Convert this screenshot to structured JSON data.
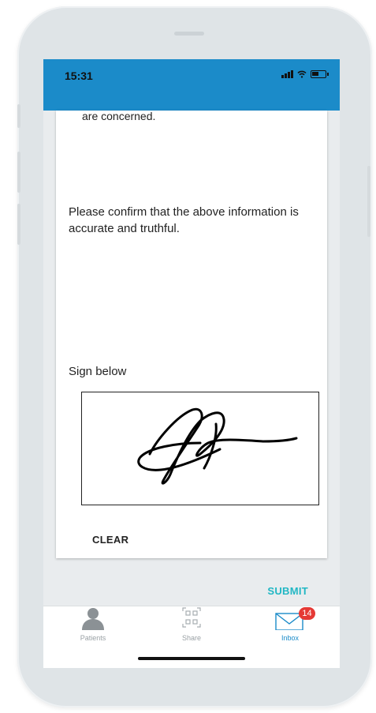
{
  "status_bar": {
    "time": "15:31",
    "background": "#1b8bc9"
  },
  "form": {
    "clipped_text": "are concerned.",
    "confirm_text": "Please confirm that the above information is accurate and truthful.",
    "sign_label": "Sign below",
    "clear_label": "CLEAR",
    "submit_label": "SUBMIT",
    "submit_color": "#21b7c4"
  },
  "tabs": [
    {
      "label": "Patients",
      "icon": "person-icon",
      "active": false
    },
    {
      "label": "Share",
      "icon": "qr-code-icon",
      "active": false
    },
    {
      "label": "Inbox",
      "icon": "envelope-icon",
      "active": true,
      "badge": "14"
    }
  ]
}
